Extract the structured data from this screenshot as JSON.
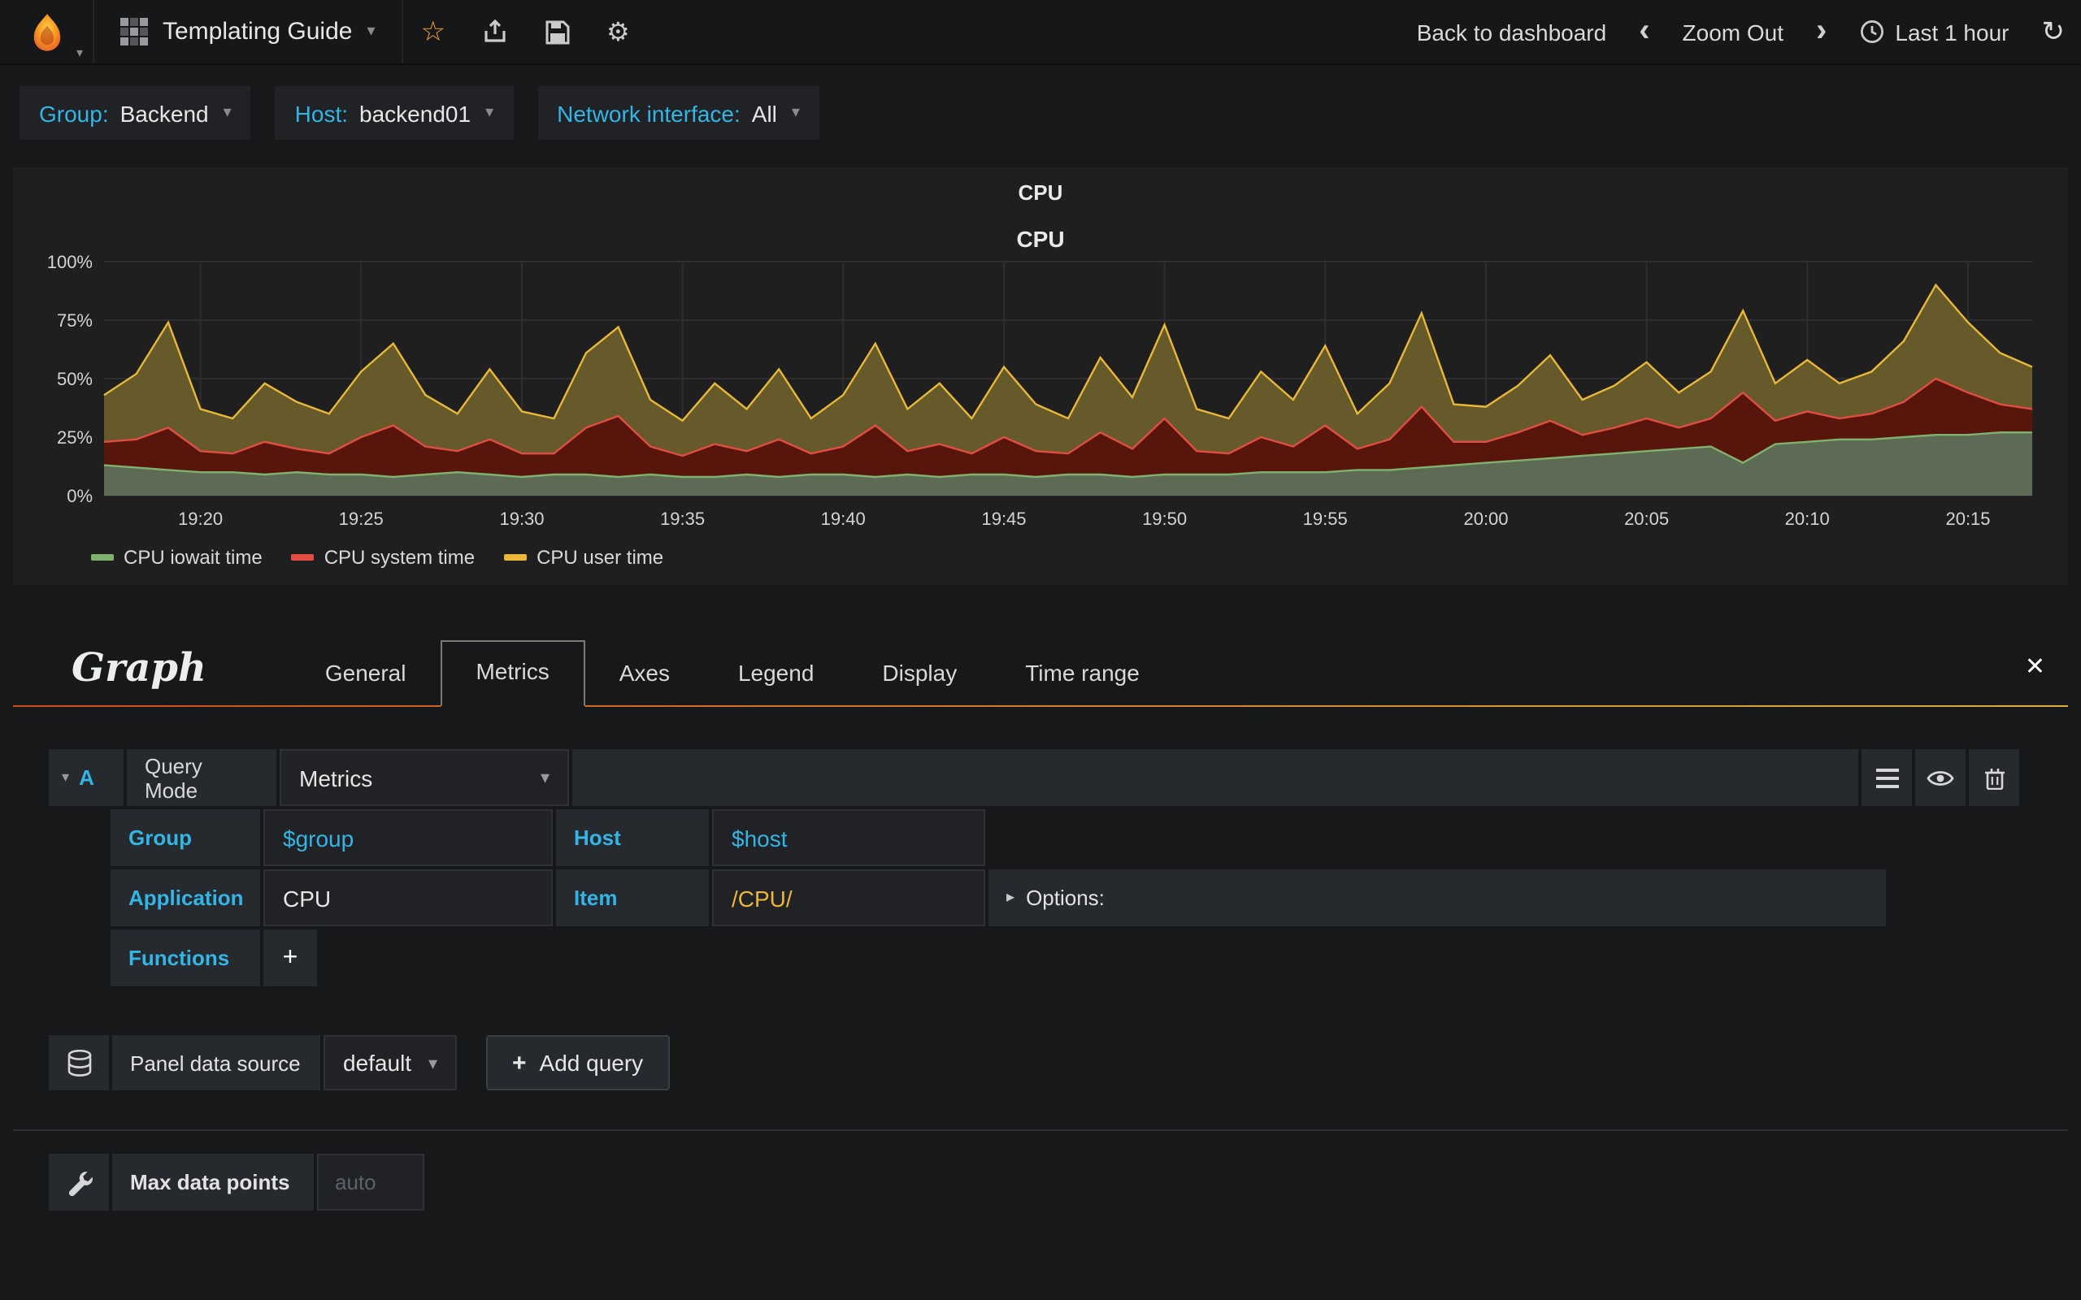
{
  "navbar": {
    "dashboard_title": "Templating Guide",
    "back_to_dashboard": "Back to dashboard",
    "zoom_out": "Zoom Out",
    "time_range": "Last 1 hour"
  },
  "icons": {
    "caret": "▾",
    "star": "☆",
    "gear": "⚙",
    "chevron_left": "‹",
    "chevron_right": "›",
    "refresh": "↻",
    "options_caret": "▸",
    "close": "✕",
    "plus": "+",
    "collapse_caret": "▾"
  },
  "variables": [
    {
      "label": "Group:",
      "value": "Backend"
    },
    {
      "label": "Host:",
      "value": "backend01"
    },
    {
      "label": "Network interface:",
      "value": "All"
    }
  ],
  "panel": {
    "title": "CPU"
  },
  "chart_data": {
    "type": "area",
    "stacked": true,
    "title": "CPU",
    "ylim": [
      0,
      100
    ],
    "y_ticks": [
      "0%",
      "25%",
      "50%",
      "75%",
      "100%"
    ],
    "x_ticks": [
      "19:20",
      "19:25",
      "19:30",
      "19:35",
      "19:40",
      "19:45",
      "19:50",
      "19:55",
      "20:00",
      "20:05",
      "20:10",
      "20:15"
    ],
    "x_tick_fracs": [
      0.05,
      0.1333,
      0.2167,
      0.3,
      0.3833,
      0.4667,
      0.55,
      0.6333,
      0.7167,
      0.8,
      0.8833,
      0.9667
    ],
    "legend_position": "bottom-left",
    "grid": true,
    "series": [
      {
        "name": "CPU iowait time",
        "color": "#7EB26D",
        "fill": "#5d6b55",
        "values": [
          13,
          12,
          11,
          10,
          10,
          9,
          10,
          9,
          9,
          8,
          9,
          10,
          9,
          8,
          9,
          9,
          8,
          9,
          8,
          8,
          9,
          8,
          9,
          9,
          8,
          9,
          8,
          9,
          9,
          8,
          9,
          9,
          8,
          9,
          9,
          9,
          10,
          10,
          10,
          11,
          11,
          12,
          13,
          14,
          15,
          16,
          17,
          18,
          19,
          20,
          21,
          14,
          22,
          23,
          24,
          24,
          25,
          26,
          26,
          27,
          27
        ]
      },
      {
        "name": "CPU system time",
        "color": "#E24D42",
        "fill": "#58150c",
        "values": [
          10,
          12,
          18,
          9,
          8,
          14,
          10,
          9,
          16,
          22,
          12,
          9,
          15,
          10,
          9,
          20,
          26,
          12,
          9,
          14,
          10,
          16,
          9,
          12,
          22,
          10,
          14,
          9,
          16,
          11,
          9,
          18,
          12,
          24,
          10,
          9,
          15,
          11,
          20,
          9,
          13,
          26,
          10,
          9,
          12,
          16,
          9,
          11,
          14,
          9,
          12,
          30,
          10,
          13,
          9,
          11,
          15,
          24,
          18,
          12,
          10
        ]
      },
      {
        "name": "CPU user time",
        "color": "#EAB839",
        "fill": "#665a2a",
        "values": [
          20,
          28,
          45,
          18,
          15,
          25,
          20,
          17,
          28,
          35,
          22,
          16,
          30,
          18,
          15,
          32,
          38,
          20,
          15,
          26,
          18,
          30,
          15,
          22,
          35,
          18,
          26,
          15,
          30,
          20,
          15,
          32,
          22,
          40,
          18,
          15,
          28,
          20,
          34,
          15,
          24,
          40,
          16,
          15,
          20,
          28,
          15,
          18,
          24,
          15,
          20,
          35,
          16,
          22,
          15,
          18,
          26,
          40,
          30,
          22,
          18
        ]
      }
    ]
  },
  "editor": {
    "title": "Graph",
    "tabs": [
      "General",
      "Metrics",
      "Axes",
      "Legend",
      "Display",
      "Time range"
    ],
    "active_tab": "Metrics",
    "query": {
      "ref_id": "A",
      "query_mode_label": "Query Mode",
      "query_mode_value": "Metrics",
      "group_label": "Group",
      "group_value": "$group",
      "host_label": "Host",
      "host_value": "$host",
      "application_label": "Application",
      "application_value": "CPU",
      "item_label": "Item",
      "item_value": "/CPU/",
      "options_label": "Options:",
      "functions_label": "Functions"
    },
    "datasource": {
      "label": "Panel data source",
      "value": "default",
      "add_query": "Add query"
    },
    "max_data_points": {
      "label": "Max data points",
      "placeholder": "auto"
    }
  }
}
